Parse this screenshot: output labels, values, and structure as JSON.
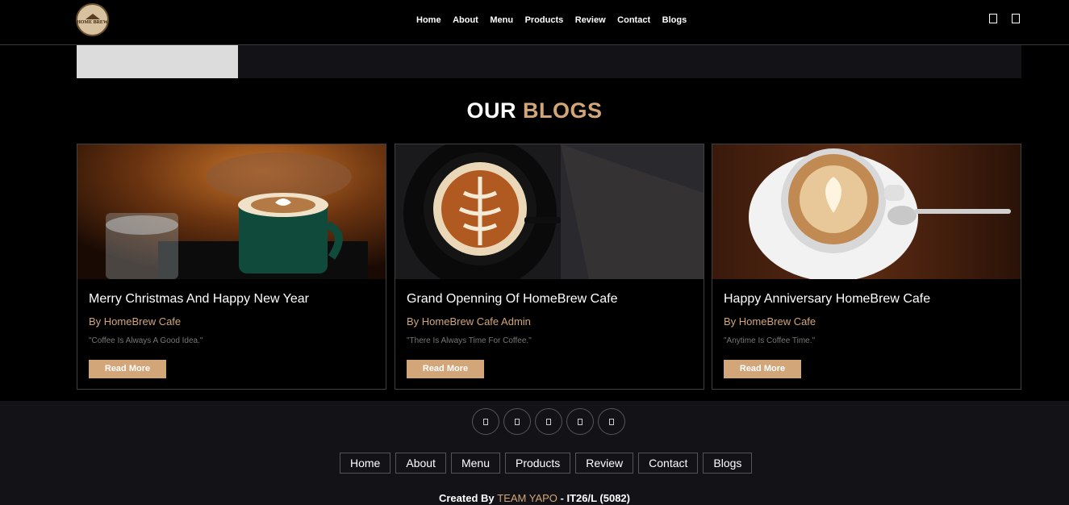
{
  "header": {
    "logo_text": "HOME BREW",
    "nav": [
      "Home",
      "About",
      "Menu",
      "Products",
      "Review",
      "Contact",
      "Blogs"
    ]
  },
  "section": {
    "title_main": "OUR",
    "title_accent": "BLOGS"
  },
  "blogs": [
    {
      "title": "Merry Christmas And Happy New Year",
      "author": "By HomeBrew Cafe",
      "quote": "\"Coffee Is Always A Good Idea.\"",
      "button": "Read More"
    },
    {
      "title": "Grand Openning Of HomeBrew Cafe",
      "author": "By HomeBrew Cafe Admin",
      "quote": "\"There Is Always Time For Coffee.\"",
      "button": "Read More"
    },
    {
      "title": "Happy Anniversary HomeBrew Cafe",
      "author": "By HomeBrew Cafe",
      "quote": "\"Anytime Is Coffee Time.\"",
      "button": "Read More"
    }
  ],
  "footer": {
    "social_icons": [
      "facebook-icon",
      "twitter-icon",
      "instagram-icon",
      "linkedin-icon",
      "pinterest-icon"
    ],
    "nav": [
      "Home",
      "About",
      "Menu",
      "Products",
      "Review",
      "Contact",
      "Blogs"
    ],
    "credit_prefix": "Created By",
    "credit_team": "TEAM YAPO",
    "credit_suffix": "- IT26/L (5082)"
  },
  "colors": {
    "accent": "#d2a679",
    "background": "#000000",
    "footer_bg": "#131317"
  }
}
